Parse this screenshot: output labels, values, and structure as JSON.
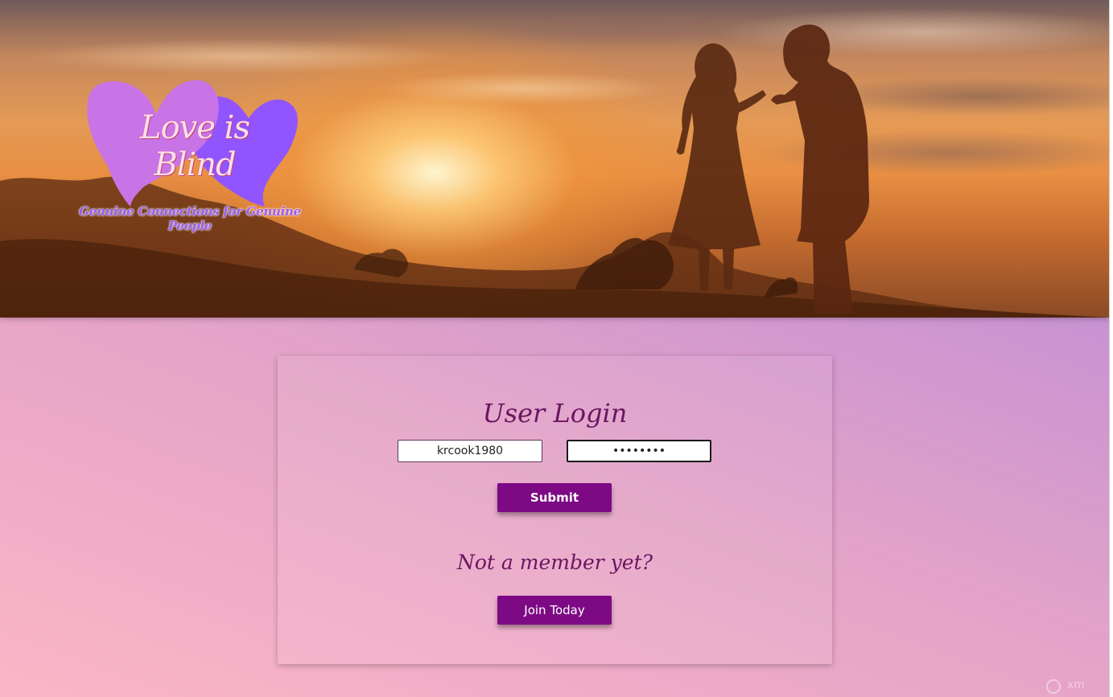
{
  "header": {
    "logo": {
      "title": "Love is Blind",
      "tagline": "Genuine Connections for Genuine People"
    }
  },
  "login": {
    "title": "User Login",
    "username_value": "krcook1980",
    "password_value": "krcook19",
    "submit_label": "Submit",
    "signup_prompt": "Not a member yet?",
    "join_label": "Join Today"
  },
  "watermark": {
    "text": "xm"
  },
  "colors": {
    "button": "#7d0a84",
    "heading": "#6b1560",
    "heart_left": "#c874e6",
    "heart_right": "#9155ff"
  }
}
